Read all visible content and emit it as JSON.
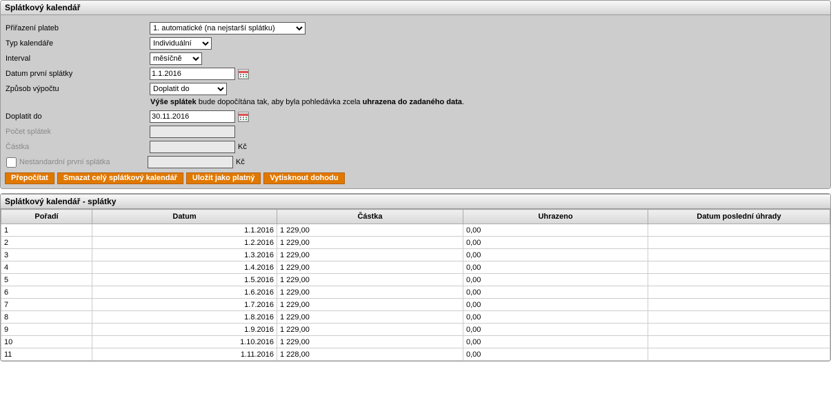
{
  "panel": {
    "title": "Splátkový kalendář",
    "labels": {
      "prirazeni": "Přiřazení plateb",
      "typ": "Typ kalendáře",
      "interval": "Interval",
      "prvni": "Datum první splátky",
      "zpusob": "Způsob výpočtu",
      "doplatit": "Doplatit do",
      "pocet": "Počet splátek",
      "castka": "Částka",
      "nestd": "Nestandardní první splátka",
      "kc": "Kč"
    },
    "values": {
      "prirazeni": "1. automatické (na nejstarší splátku)",
      "typ": "Individuální",
      "interval": "měsíčně",
      "prvni": "1.1.2016",
      "zpusob": "Doplatit do",
      "doplatit": "30.11.2016",
      "pocet": "",
      "castka": "",
      "nestd_amount": ""
    },
    "desc": {
      "b1": "Výše splátek",
      "mid": " bude dopočítána tak, aby byla pohledávka zcela ",
      "b2": "uhrazena do zadaného data",
      "end": "."
    },
    "buttons": {
      "prepocitat": "Přepočítat",
      "smazat": "Smazat celý splátkový kalendář",
      "ulozit": "Uložit jako platný",
      "vytisk": "Vytisknout dohodu"
    }
  },
  "table": {
    "title": "Splátkový kalendář - splátky",
    "headers": {
      "poradi": "Pořadí",
      "datum": "Datum",
      "castka": "Částka",
      "uhrazeno": "Uhrazeno",
      "posledni": "Datum poslední úhrady"
    },
    "rows": [
      {
        "poradi": "1",
        "datum": "1.1.2016",
        "castka": "1 229,00",
        "uhrazeno": "0,00",
        "posledni": ""
      },
      {
        "poradi": "2",
        "datum": "1.2.2016",
        "castka": "1 229,00",
        "uhrazeno": "0,00",
        "posledni": ""
      },
      {
        "poradi": "3",
        "datum": "1.3.2016",
        "castka": "1 229,00",
        "uhrazeno": "0,00",
        "posledni": ""
      },
      {
        "poradi": "4",
        "datum": "1.4.2016",
        "castka": "1 229,00",
        "uhrazeno": "0,00",
        "posledni": ""
      },
      {
        "poradi": "5",
        "datum": "1.5.2016",
        "castka": "1 229,00",
        "uhrazeno": "0,00",
        "posledni": ""
      },
      {
        "poradi": "6",
        "datum": "1.6.2016",
        "castka": "1 229,00",
        "uhrazeno": "0,00",
        "posledni": ""
      },
      {
        "poradi": "7",
        "datum": "1.7.2016",
        "castka": "1 229,00",
        "uhrazeno": "0,00",
        "posledni": ""
      },
      {
        "poradi": "8",
        "datum": "1.8.2016",
        "castka": "1 229,00",
        "uhrazeno": "0,00",
        "posledni": ""
      },
      {
        "poradi": "9",
        "datum": "1.9.2016",
        "castka": "1 229,00",
        "uhrazeno": "0,00",
        "posledni": ""
      },
      {
        "poradi": "10",
        "datum": "1.10.2016",
        "castka": "1 229,00",
        "uhrazeno": "0,00",
        "posledni": ""
      },
      {
        "poradi": "11",
        "datum": "1.11.2016",
        "castka": "1 228,00",
        "uhrazeno": "0,00",
        "posledni": ""
      }
    ]
  }
}
